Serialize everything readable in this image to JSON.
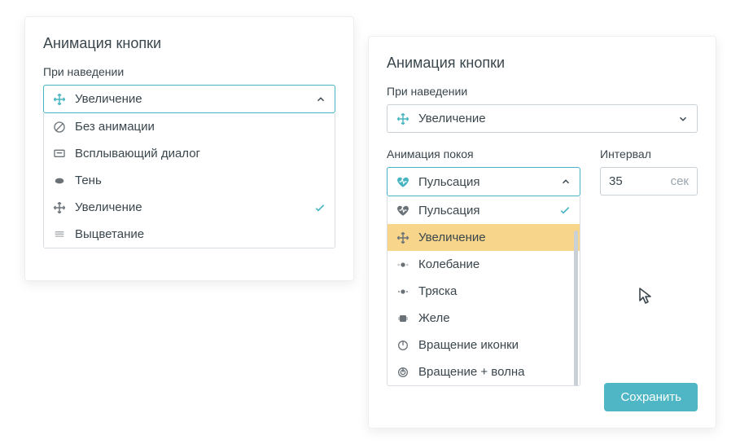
{
  "left": {
    "title": "Анимация кнопки",
    "hover_label": "При наведении",
    "selected": "Увеличение",
    "selected_icon": "move",
    "items": [
      {
        "icon": "none",
        "label": "Без анимации",
        "checked": false
      },
      {
        "icon": "dialog",
        "label": "Всплывающий диалог",
        "checked": false
      },
      {
        "icon": "shadow",
        "label": "Тень",
        "checked": false
      },
      {
        "icon": "move",
        "label": "Увеличение",
        "checked": true
      },
      {
        "icon": "fade",
        "label": "Выцветание",
        "checked": false
      }
    ]
  },
  "right": {
    "title": "Анимация кнопки",
    "hover_label": "При наведении",
    "hover_selected": "Увеличение",
    "hover_icon": "move",
    "rest_label": "Анимация покоя",
    "rest_selected": "Пульсация",
    "rest_icon": "pulse",
    "rest_items": [
      {
        "icon": "pulse",
        "label": "Пульсация",
        "checked": true,
        "highlight": false
      },
      {
        "icon": "move",
        "label": "Увеличение",
        "checked": false,
        "highlight": true
      },
      {
        "icon": "wobble",
        "label": "Колебание",
        "checked": false,
        "highlight": false
      },
      {
        "icon": "shake",
        "label": "Тряска",
        "checked": false,
        "highlight": false
      },
      {
        "icon": "jelly",
        "label": "Желе",
        "checked": false,
        "highlight": false
      },
      {
        "icon": "spin",
        "label": "Вращение иконки",
        "checked": false,
        "highlight": false
      },
      {
        "icon": "wave",
        "label": "Вращение + волна",
        "checked": false,
        "highlight": false
      }
    ],
    "interval_label": "Интервал",
    "interval_value": "35",
    "interval_unit": "сек",
    "save_label": "Сохранить"
  }
}
